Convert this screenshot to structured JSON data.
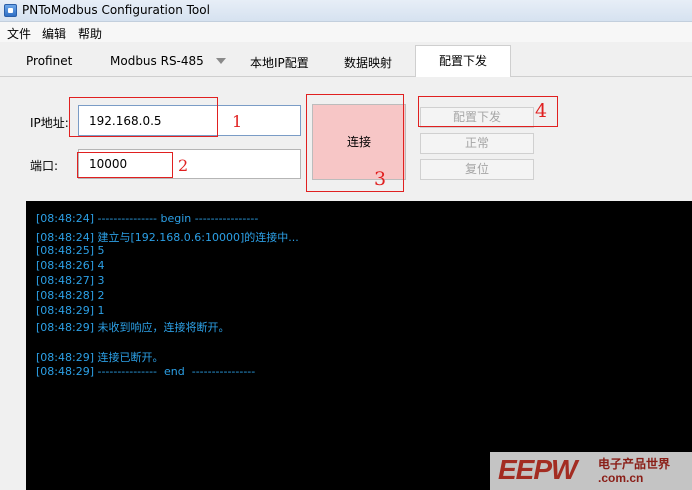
{
  "window": {
    "title": "PNToModbus Configuration Tool"
  },
  "menu": {
    "items": [
      "文件",
      "编辑",
      "帮助"
    ]
  },
  "tabs": [
    "Profinet",
    "Modbus RS-485",
    "本地IP配置",
    "数据映射",
    "配置下发"
  ],
  "form": {
    "ip_label": "IP地址:",
    "ip_value": "192.168.0.5",
    "port_label": "端口:",
    "port_value": "10000"
  },
  "buttons": {
    "connect": "连接",
    "deploy": "配置下发",
    "normal": "正常",
    "reset": "复位"
  },
  "annotations": [
    "1",
    "2",
    "3",
    "4"
  ],
  "console": {
    "lines": [
      "[08:48:24] --------------- begin ----------------",
      "[08:48:24] 建立与[192.168.0.6:10000]的连接中...",
      "[08:48:25] 5",
      "[08:48:26] 4",
      "[08:48:27] 3",
      "[08:48:28] 2",
      "[08:48:29] 1",
      "[08:48:29] 未收到响应，连接将断开。",
      "",
      "[08:48:29] 连接已断开。",
      "[08:48:29] ---------------  end  ----------------"
    ]
  },
  "watermark": {
    "logo": "EEPW",
    "cn": "电子产品世界",
    "url": ".com.cn"
  },
  "colors": {
    "console_text": "#2ca0e6",
    "annotation": "#e02020",
    "connect_bg": "#f7c6c6"
  }
}
